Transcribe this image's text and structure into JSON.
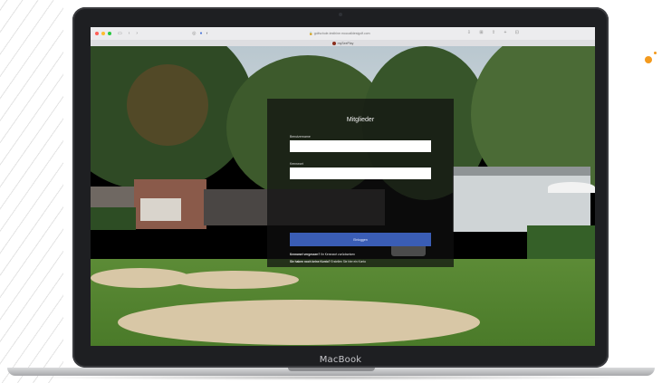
{
  "browser": {
    "url": "golfschule-testhine.mocoalldesigolf.com",
    "tab_title": "mySeePlay"
  },
  "login": {
    "title": "Mitglieder",
    "username_label": "Benutzername",
    "password_label": "Kennwort",
    "username_value": "",
    "password_value": "",
    "submit_label": "Einloggen",
    "forgot_text": "Kennwort vergessen?",
    "forgot_link": "Ihr Kennwort zurücksetzen",
    "register_text": "Sie haben noch keine Konto?",
    "register_link": "Erstellen Sie hier ein Konto"
  },
  "device": {
    "brand": "MacBook"
  },
  "colors": {
    "accent": "#3a5db5",
    "panel": "#0f0f0f",
    "brand_orange": "#f39a1e"
  }
}
